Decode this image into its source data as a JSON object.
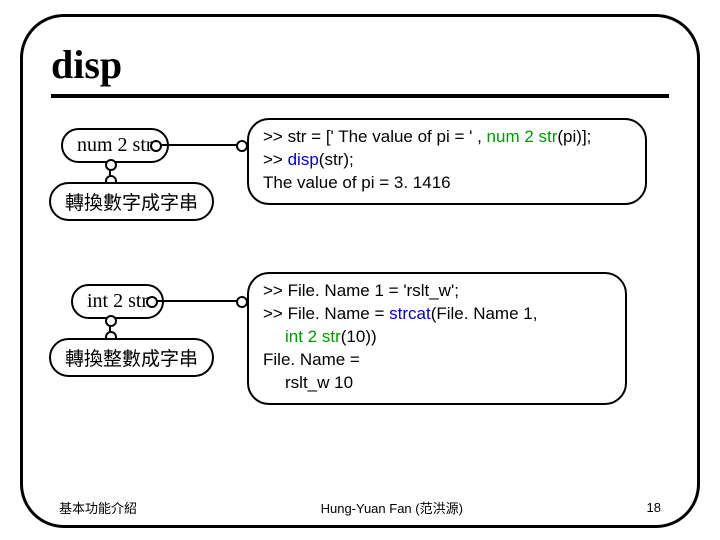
{
  "title": "disp",
  "pills": {
    "num2str": "num 2 str",
    "num2str_desc": "轉換數字成字串",
    "int2str": "int 2 str",
    "int2str_desc": "轉換整數成字串"
  },
  "code1": {
    "l1a": ">> str = [' The value of pi = ' , ",
    "l1b": "num 2 str",
    "l1c": "(pi)];",
    "l2a": ">> ",
    "l2b": "disp",
    "l2c": "(str);",
    "l3": "The value of pi = 3. 1416"
  },
  "code2": {
    "l1": ">> File. Name 1  = 'rslt_w';",
    "l2a": ">> File. Name  = ",
    "l2b": "strcat",
    "l2c": "(File. Name 1, ",
    "l3a": "int 2 str",
    "l3b": "(10))",
    "l4": "File. Name = ",
    "l5": "rslt_w 10"
  },
  "footer": {
    "left": "基本功能介紹",
    "center": "Hung-Yuan Fan (范洪源)",
    "right": "18"
  }
}
